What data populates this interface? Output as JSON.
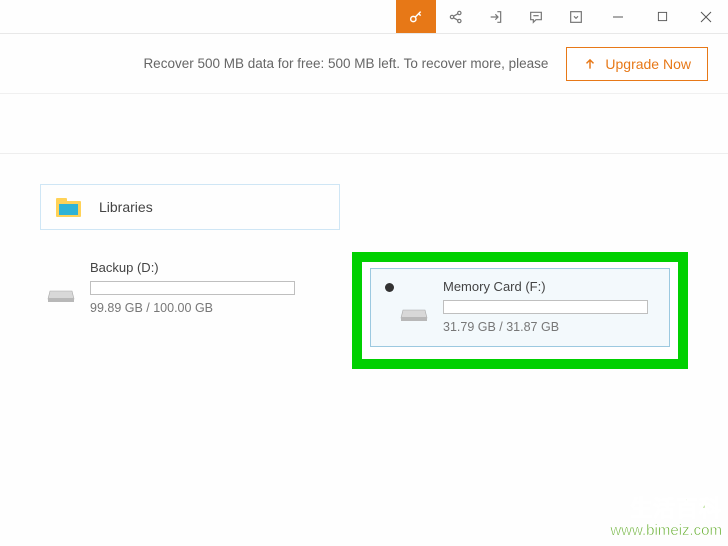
{
  "promo": {
    "text": "Recover 500 MB data for free: 500 MB left. To recover more, please",
    "button_label": "Upgrade Now"
  },
  "libraries": {
    "label": "Libraries"
  },
  "drives": [
    {
      "name": "Backup (D:)",
      "size_text": "99.89 GB / 100.00 GB",
      "selected": false
    },
    {
      "name": "Memory Card (F:)",
      "size_text": "31.79 GB / 31.87 GB",
      "selected": true
    }
  ],
  "watermark": {
    "line1": "生活百科",
    "line2": "www.bimeiz.com"
  }
}
